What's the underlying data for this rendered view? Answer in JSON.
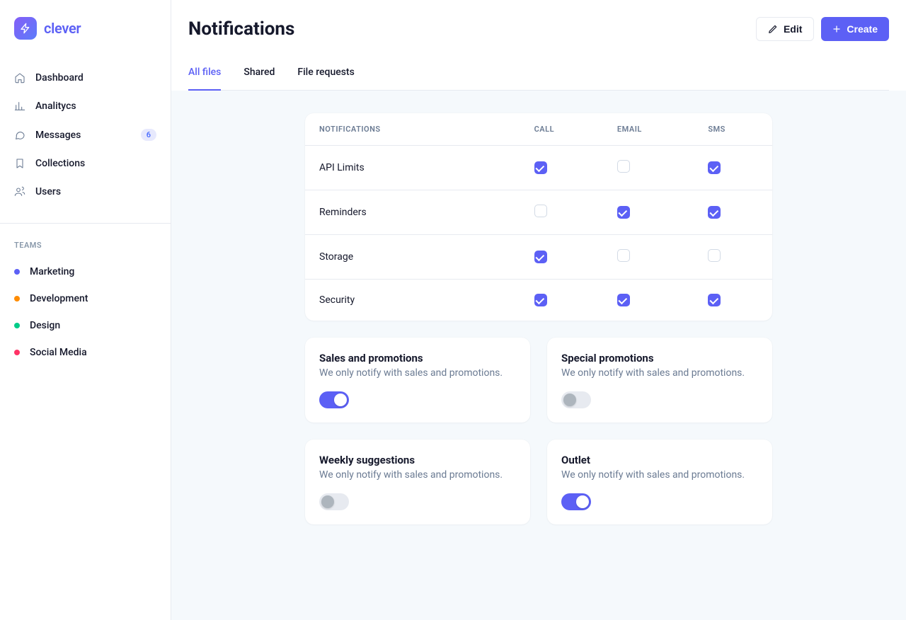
{
  "brand": {
    "name": "clever"
  },
  "sidebar": {
    "items": [
      {
        "label": "Dashboard",
        "icon": "home"
      },
      {
        "label": "Analitycs",
        "icon": "chart"
      },
      {
        "label": "Messages",
        "icon": "chat",
        "badge": "6"
      },
      {
        "label": "Collections",
        "icon": "bookmark"
      },
      {
        "label": "Users",
        "icon": "users"
      }
    ],
    "teams_label": "TEAMS",
    "teams": [
      {
        "label": "Marketing",
        "color": "#5C60F5"
      },
      {
        "label": "Development",
        "color": "#FF8C00"
      },
      {
        "label": "Design",
        "color": "#00CC88"
      },
      {
        "label": "Social Media",
        "color": "#FF3366"
      }
    ]
  },
  "header": {
    "title": "Notifications",
    "edit_label": "Edit",
    "create_label": "Create",
    "tabs": [
      {
        "label": "All files",
        "active": true
      },
      {
        "label": "Shared",
        "active": false
      },
      {
        "label": "File requests",
        "active": false
      }
    ]
  },
  "table": {
    "columns": [
      "NOTIFICATIONS",
      "CALL",
      "EMAIL",
      "SMS"
    ],
    "rows": [
      {
        "label": "API Limits",
        "call": true,
        "email": false,
        "sms": true
      },
      {
        "label": "Reminders",
        "call": false,
        "email": true,
        "sms": true
      },
      {
        "label": "Storage",
        "call": true,
        "email": false,
        "sms": false
      },
      {
        "label": "Security",
        "call": true,
        "email": true,
        "sms": true
      }
    ]
  },
  "toggles": [
    {
      "title": "Sales and promotions",
      "desc": "We only notify with sales and promotions.",
      "on": true
    },
    {
      "title": "Special promotions",
      "desc": "We only notify with sales and promotions.",
      "on": false
    },
    {
      "title": "Weekly suggestions",
      "desc": "We only notify with sales and promotions.",
      "on": false
    },
    {
      "title": "Outlet",
      "desc": "We only notify with sales and promotions.",
      "on": true
    }
  ]
}
